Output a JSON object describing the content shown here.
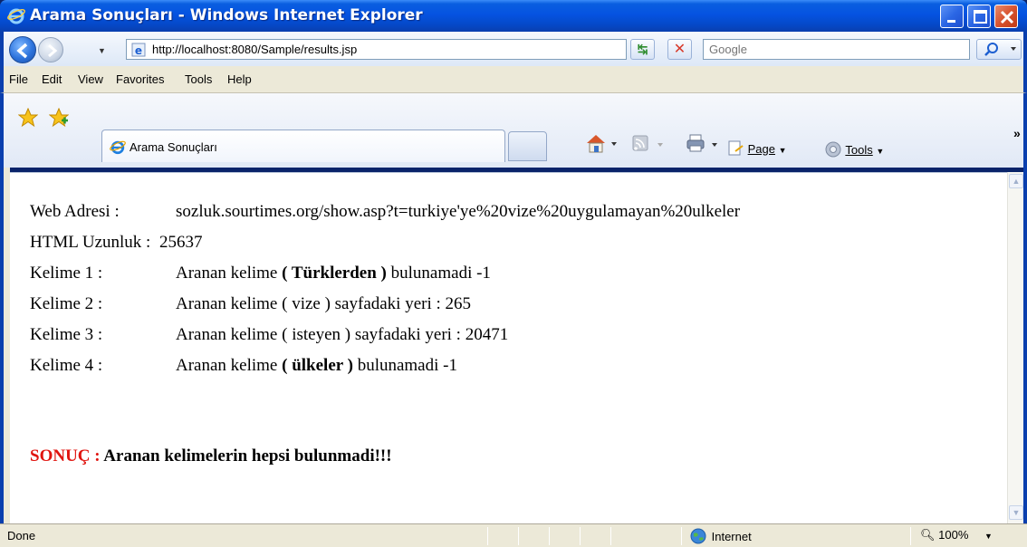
{
  "window": {
    "title": "Arama Sonuçları - Windows Internet Explorer"
  },
  "address_bar": {
    "url": "http://localhost:8080/Sample/results.jsp"
  },
  "search": {
    "placeholder": "Google"
  },
  "menu": {
    "items": [
      "File",
      "Edit",
      "View",
      "Favorites",
      "Tools",
      "Help"
    ]
  },
  "tabs": {
    "active_label": "Arama Sonuçları"
  },
  "command_bar": {
    "page_label": "Page",
    "tools_label": "Tools"
  },
  "content": {
    "rows": [
      {
        "key": "Web Adresi :",
        "value": "sozluk.sourtimes.org/show.asp?t=turkiye'ye%20vize%20uygulamayan%20ulkeler"
      },
      {
        "key": "HTML Uzunluk :",
        "value": "25637"
      },
      {
        "key": "Kelime 1 :",
        "prefix": "Aranan kelime ",
        "bold": "( Türklerden )",
        "suffix": " bulunamadi -1"
      },
      {
        "key": "Kelime 2 :",
        "value": "Aranan kelime ( vize ) sayfadaki yeri : 265"
      },
      {
        "key": "Kelime 3 :",
        "value": "Aranan kelime ( isteyen ) sayfadaki yeri : 20471"
      },
      {
        "key": "Kelime 4 :",
        "prefix": "Aranan kelime ",
        "bold": "( ülkeler )",
        "suffix": " bulunamadi -1"
      }
    ],
    "result_label": "SONUÇ :",
    "result_text": "Aranan kelimelerin hepsi bulunmadi!!!",
    "result_label_color": "#e0140f"
  },
  "status_bar": {
    "status": "Done",
    "zone": "Internet",
    "zoom": "100%"
  }
}
